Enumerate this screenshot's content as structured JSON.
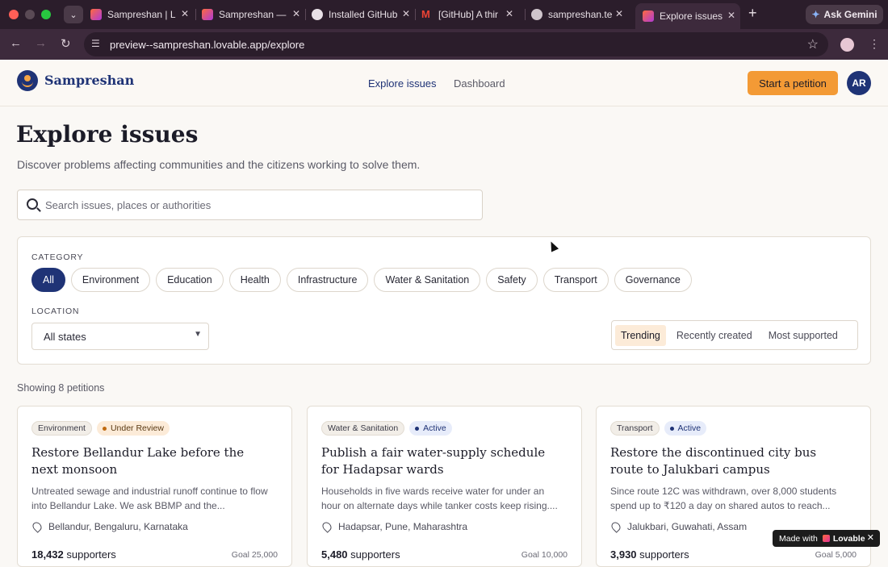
{
  "browser": {
    "tabs": [
      {
        "title": "Sampreshan | L",
        "icon": "lovable-icon"
      },
      {
        "title": "Sampreshan —",
        "icon": "lovable-icon"
      },
      {
        "title": "Installed GitHub",
        "icon": "github-icon"
      },
      {
        "title": "[GitHub] A thir",
        "icon": "gmail-icon"
      },
      {
        "title": "sampreshan.te",
        "icon": "globe-icon"
      },
      {
        "title": "Explore issues",
        "icon": "lovable-icon"
      }
    ],
    "ask_gemini": "Ask Gemini",
    "url": "preview--sampreshan.lovable.app/explore"
  },
  "header": {
    "brand": "Sampreshan",
    "nav": [
      "Explore issues",
      "Dashboard"
    ],
    "cta": "Start a petition",
    "avatar_initials": "AR"
  },
  "main": {
    "title": "Explore issues",
    "subtitle": "Discover problems affecting communities and the citizens working to solve them.",
    "search_placeholder": "Search issues, places or authorities",
    "category_label": "CATEGORY",
    "categories": [
      "All",
      "Environment",
      "Education",
      "Health",
      "Infrastructure",
      "Water & Sanitation",
      "Safety",
      "Transport",
      "Governance"
    ],
    "selected_category": "All",
    "location_label": "LOCATION",
    "location_value": "All states",
    "sort_options": [
      "Trending",
      "Recently created",
      "Most supported"
    ],
    "selected_sort": "Trending",
    "showing": "Showing 8 petitions"
  },
  "cards": [
    {
      "category": "Environment",
      "status": "Under Review",
      "title": "Restore Bellandur Lake before the next monsoon",
      "description": "Untreated sewage and industrial runoff continue to flow into Bellandur Lake. We ask BBMP and the...",
      "location": "Bellandur, Bengaluru, Karnataka",
      "supporters": "18,432",
      "supporters_label": "supporters",
      "goal": "Goal 25,000"
    },
    {
      "category": "Water & Sanitation",
      "status": "Active",
      "title": "Publish a fair water-supply schedule for Hadapsar wards",
      "description": "Households in five wards receive water for under an hour on alternate days while tanker costs keep rising....",
      "location": "Hadapsar, Pune, Maharashtra",
      "supporters": "5,480",
      "supporters_label": "supporters",
      "goal": "Goal 10,000"
    },
    {
      "category": "Transport",
      "status": "Active",
      "title": "Restore the discontinued city bus route to Jalukbari campus",
      "description": "Since route 12C was withdrawn, over 8,000 students spend up to ₹120 a day on shared autos to reach...",
      "location": "Jalukbari, Guwahati, Assam",
      "supporters": "3,930",
      "supporters_label": "supporters",
      "goal": "Goal 5,000"
    }
  ],
  "lovable_badge": {
    "made_with": "Made with",
    "brand": "Lovable",
    "close": "✕"
  }
}
